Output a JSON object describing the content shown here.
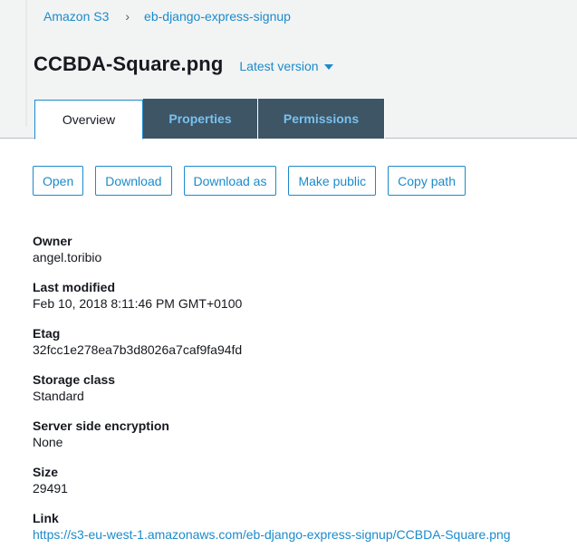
{
  "breadcrumb": {
    "root": "Amazon S3",
    "separator": "›",
    "bucket": "eb-django-express-signup"
  },
  "object": {
    "name": "CCBDA-Square.png",
    "version_label": "Latest version"
  },
  "tabs": [
    {
      "label": "Overview",
      "active": true
    },
    {
      "label": "Properties",
      "active": false
    },
    {
      "label": "Permissions",
      "active": false
    }
  ],
  "actions": {
    "open": "Open",
    "download": "Download",
    "download_as": "Download as",
    "make_public": "Make public",
    "copy_path": "Copy path"
  },
  "details": {
    "owner": {
      "label": "Owner",
      "value": "angel.toribio"
    },
    "last_modified": {
      "label": "Last modified",
      "value": "Feb 10, 2018 8:11:46 PM GMT+0100"
    },
    "etag": {
      "label": "Etag",
      "value": "32fcc1e278ea7b3d8026a7caf9fa94fd"
    },
    "storage_class": {
      "label": "Storage class",
      "value": "Standard"
    },
    "encryption": {
      "label": "Server side encryption",
      "value": "None"
    },
    "size": {
      "label": "Size",
      "value": "29491"
    },
    "link": {
      "label": "Link",
      "value": "https://s3-eu-west-1.amazonaws.com/eb-django-express-signup/CCBDA-Square.png"
    }
  },
  "colors": {
    "accent": "#1b8bcb",
    "tab_dark": "#3d5565",
    "header_bg": "#f2f3f3"
  }
}
